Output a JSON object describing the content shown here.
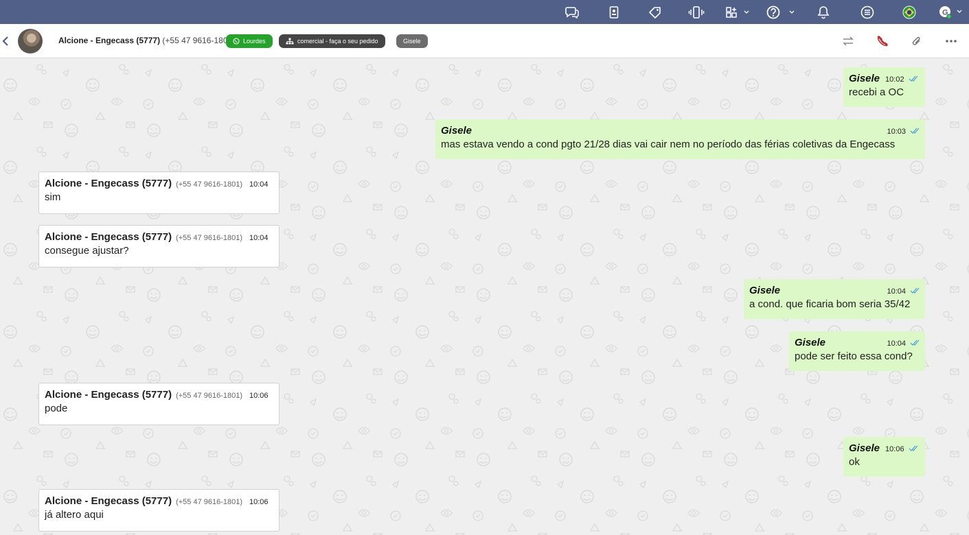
{
  "header": {
    "contact_name": "Alcione - Engecass (5777)",
    "contact_phone": "(+55 47 9616-1801)",
    "tags": [
      {
        "label": "Lourdes",
        "color": "#25a32a",
        "icon": "whatsapp-icon"
      },
      {
        "label": "comercial - faça o seu pedido",
        "color": "#454545",
        "icon": "sitemap-icon"
      },
      {
        "label": "Gisele",
        "color": "#6c6c6c"
      }
    ]
  },
  "topbar": {
    "color": "#506089",
    "icons": [
      "chat-icon",
      "contacts-book-icon",
      "tag-icon",
      "phone-vibrate-icon",
      "add-widget-icon",
      "help-icon",
      "bell-icon",
      "list-icon",
      "brazil-flag-icon",
      "user-avatar-icon"
    ]
  },
  "messages": [
    {
      "dir": "out",
      "sender": "Gisele",
      "time": "10:02",
      "text": "recebi a OC"
    },
    {
      "dir": "out",
      "sender": "Gisele",
      "time": "10:03",
      "text": "mas estava vendo a cond pgto 21/28 dias vai cair nem no período das férias coletivas da Engecass"
    },
    {
      "dir": "in",
      "sender": "Alcione - Engecass (5777)",
      "phone": "(+55 47 9616-1801)",
      "time": "10:04",
      "text": "sim"
    },
    {
      "dir": "in",
      "sender": "Alcione - Engecass (5777)",
      "phone": "(+55 47 9616-1801)",
      "time": "10:04",
      "text": "consegue ajustar?"
    },
    {
      "dir": "out",
      "sender": "Gisele",
      "time": "10:04",
      "text": "a cond. que ficaria bom seria 35/42"
    },
    {
      "dir": "out",
      "sender": "Gisele",
      "time": "10:04",
      "text": "pode ser feito essa cond?"
    },
    {
      "dir": "in",
      "sender": "Alcione - Engecass (5777)",
      "phone": "(+55 47 9616-1801)",
      "time": "10:06",
      "text": "pode"
    },
    {
      "dir": "out",
      "sender": "Gisele",
      "time": "10:06",
      "text": "ok"
    },
    {
      "dir": "in",
      "sender": "Alcione - Engecass (5777)",
      "phone": "(+55 47 9616-1801)",
      "time": "10:06",
      "text": "já altero aqui"
    }
  ],
  "colors": {
    "outgoing_bubble": "#dcf8c6",
    "incoming_bubble": "#ffffff",
    "read_ticks": "#4fa3e0",
    "background": "#efefef"
  }
}
